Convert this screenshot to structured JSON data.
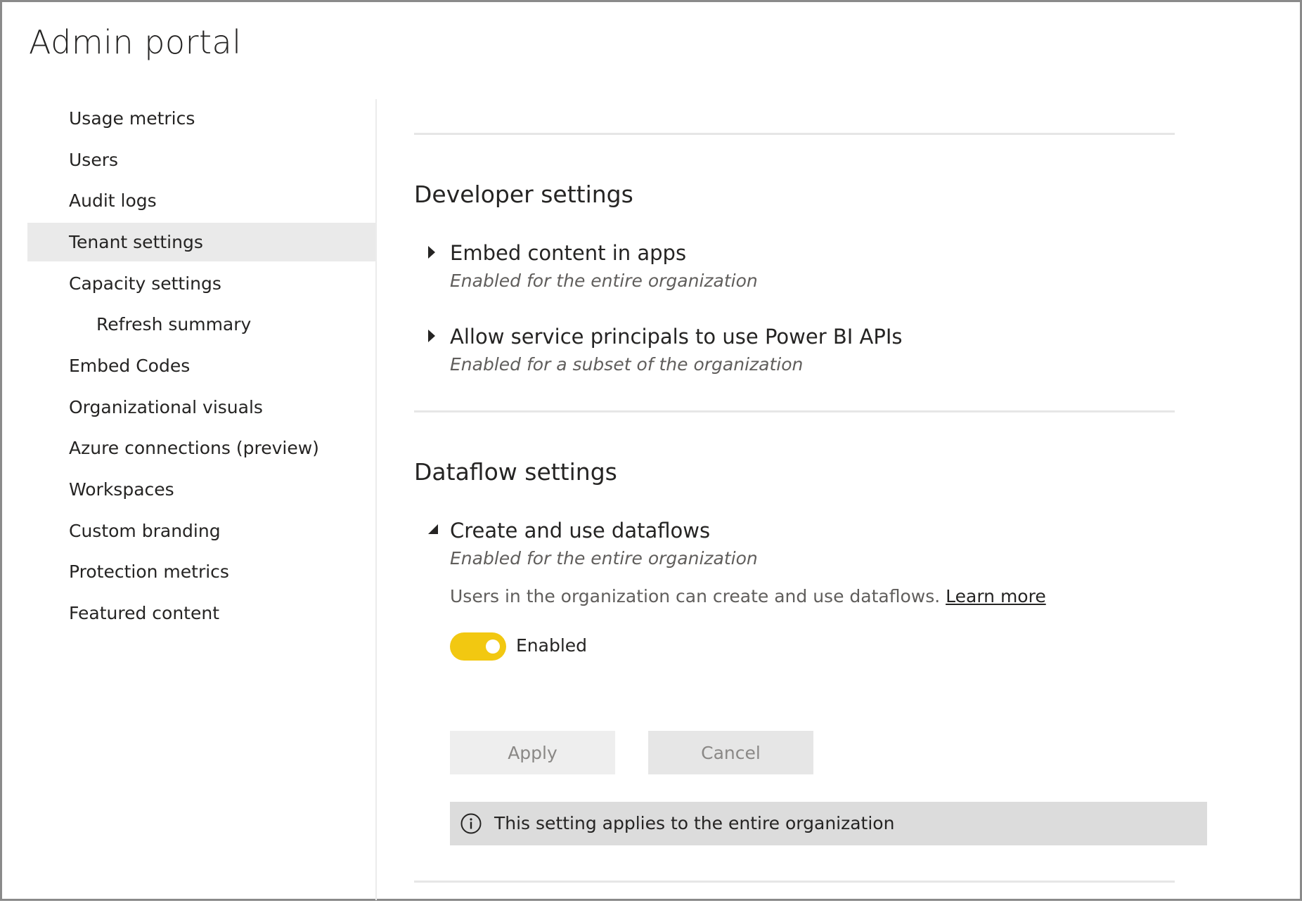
{
  "app": {
    "title": "Admin portal"
  },
  "sidebar": {
    "items": [
      {
        "label": "Usage metrics"
      },
      {
        "label": "Users"
      },
      {
        "label": "Audit logs"
      },
      {
        "label": "Tenant settings",
        "selected": true
      },
      {
        "label": "Capacity settings"
      },
      {
        "label": "Refresh summary",
        "sub": true
      },
      {
        "label": "Embed Codes"
      },
      {
        "label": "Organizational visuals"
      },
      {
        "label": "Azure connections (preview)"
      },
      {
        "label": "Workspaces"
      },
      {
        "label": "Custom branding"
      },
      {
        "label": "Protection metrics"
      },
      {
        "label": "Featured content"
      }
    ]
  },
  "developer": {
    "title": "Developer settings",
    "settings": [
      {
        "name": "Embed content in apps",
        "status": "Enabled for the entire organization",
        "expanded": false
      },
      {
        "name": "Allow service principals to use Power BI APIs",
        "status": "Enabled for a subset of the organization",
        "expanded": false
      }
    ]
  },
  "dataflow": {
    "title": "Dataflow settings",
    "setting": {
      "name": "Create and use dataflows",
      "status": "Enabled for the entire organization",
      "expanded": true,
      "description": "Users in the organization can create and use dataflows.",
      "learn_more": "Learn more",
      "toggle_label": "Enabled",
      "toggle_on": true
    },
    "apply_label": "Apply",
    "cancel_label": "Cancel",
    "info_text": "This setting applies to the entire organization"
  },
  "colors": {
    "toggle_on": "#f2c811",
    "selected_nav_bg": "#eaeaea",
    "info_bar_bg": "#dcdcdc",
    "button_bg": "#eeeeee",
    "disabled_text": "#8a8886"
  },
  "icons": {
    "collapsed": "caret-right-icon",
    "expanded": "caret-expanded-icon",
    "info": "info-icon"
  }
}
